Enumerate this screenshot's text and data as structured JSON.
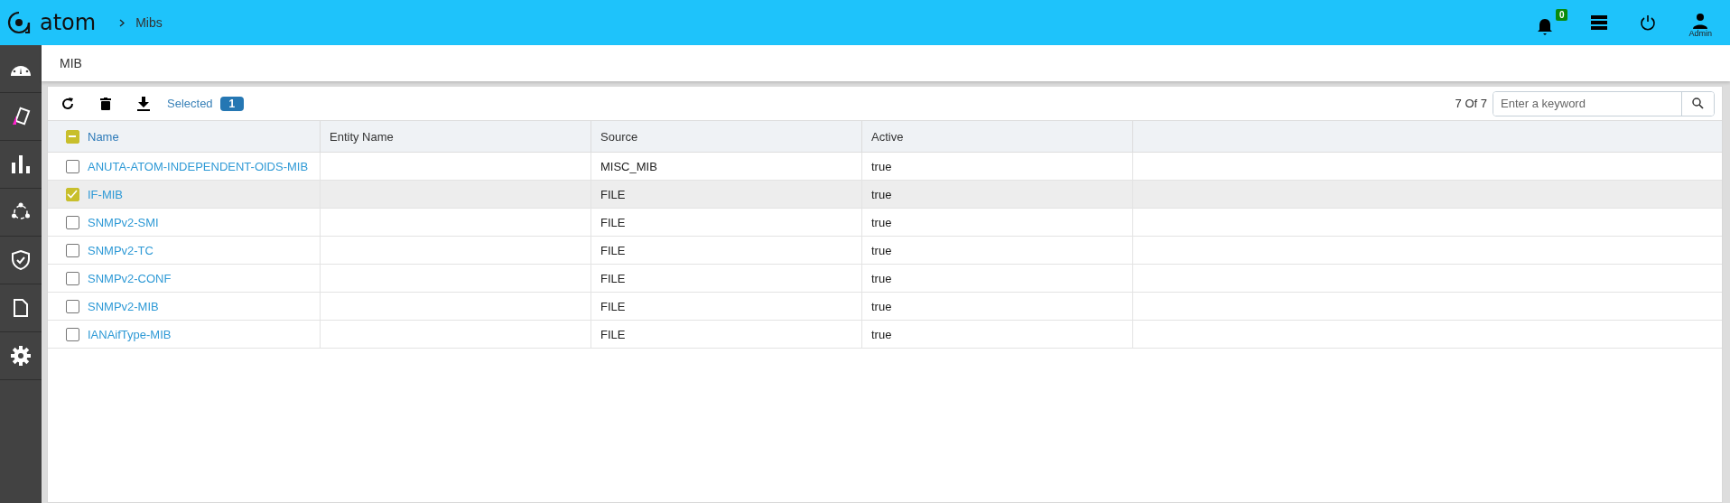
{
  "header": {
    "logo": "atom",
    "breadcrumb": "Mibs",
    "notifications": "0",
    "user": "Admin"
  },
  "page_title": "MIB",
  "toolbar": {
    "selected_label": "Selected",
    "selected_count": "1",
    "count": "7 Of 7",
    "search": {
      "placeholder": "Enter a keyword"
    }
  },
  "table": {
    "header_checkbox": {
      "indeterminate": true
    },
    "columns": [
      "Name",
      "Entity Name",
      "Source",
      "Active"
    ],
    "rows": [
      {
        "name": "ANUTA-ATOM-INDEPENDENT-OIDS-MIB",
        "entity_name": "",
        "source": "MISC_MIB",
        "active": "true",
        "selected": false
      },
      {
        "name": "IF-MIB",
        "entity_name": "",
        "source": "FILE",
        "active": "true",
        "selected": true
      },
      {
        "name": "SNMPv2-SMI",
        "entity_name": "",
        "source": "FILE",
        "active": "true",
        "selected": false
      },
      {
        "name": "SNMPv2-TC",
        "entity_name": "",
        "source": "FILE",
        "active": "true",
        "selected": false
      },
      {
        "name": "SNMPv2-CONF",
        "entity_name": "",
        "source": "FILE",
        "active": "true",
        "selected": false
      },
      {
        "name": "SNMPv2-MIB",
        "entity_name": "",
        "source": "FILE",
        "active": "true",
        "selected": false
      },
      {
        "name": "IANAifType-MIB",
        "entity_name": "",
        "source": "FILE",
        "active": "true",
        "selected": false
      }
    ]
  }
}
